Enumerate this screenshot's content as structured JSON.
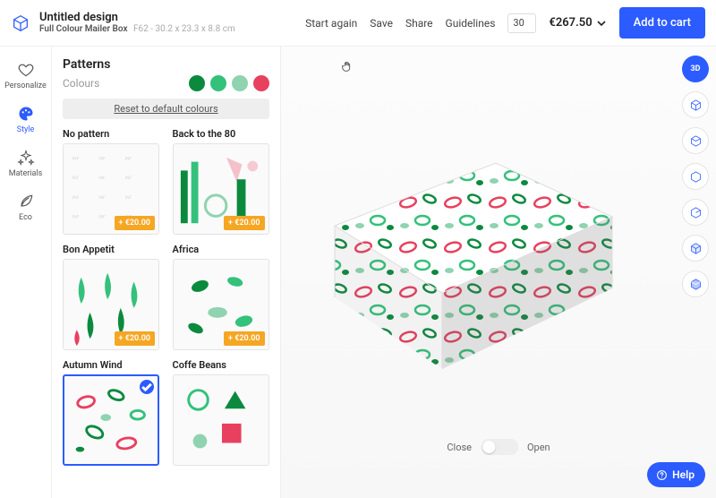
{
  "header": {
    "design_title": "Untitled design",
    "product_name": "Full Colour Mailer Box",
    "sku": "F62",
    "dimensions": "30.2 x 23.3 x 8.8 cm",
    "actions": {
      "start_again": "Start again",
      "save": "Save",
      "share": "Share",
      "guidelines": "Guidelines"
    },
    "quantity": "30",
    "price": "€267.50",
    "add_to_cart": "Add to cart"
  },
  "nav": {
    "personalize": "Personalize",
    "style": "Style",
    "materials": "Materials",
    "eco": "Eco"
  },
  "panel": {
    "title": "Patterns",
    "colours_label": "Colours",
    "swatches": [
      "#0b8a3e",
      "#34c17b",
      "#8fd3b0",
      "#e8405f"
    ],
    "reset_label": "Reset to default colours",
    "price_badge": "+ €20.00",
    "tiles": [
      {
        "label": "No pattern",
        "badge": true
      },
      {
        "label": "Back to the 80",
        "badge": true
      },
      {
        "label": "Bon Appetit",
        "badge": true
      },
      {
        "label": "Africa",
        "badge": true
      },
      {
        "label": "Autumn Wind",
        "selected": true
      },
      {
        "label": "Coffe Beans"
      }
    ]
  },
  "viewer": {
    "toggle_close": "Close",
    "toggle_open": "Open",
    "mode3d": "3D"
  },
  "help": {
    "label": "Help"
  }
}
